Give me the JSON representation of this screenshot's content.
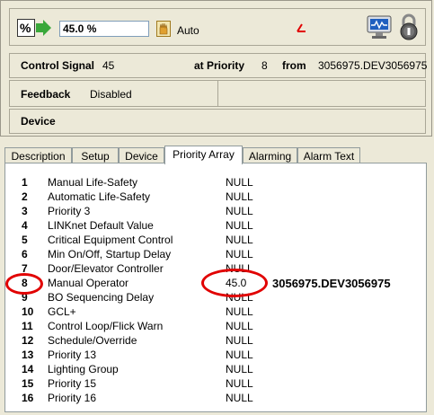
{
  "header": {
    "value": "45.0 %",
    "mode": "Auto"
  },
  "control": {
    "label": "Control Signal",
    "value": "45",
    "priority_label": "at Priority",
    "priority": "8",
    "from_label": "from",
    "source": "3056975.DEV3056975"
  },
  "feedback": {
    "label": "Feedback",
    "value": "Disabled"
  },
  "device": {
    "label": "Device"
  },
  "tabs": [
    "Description",
    "Setup",
    "Device",
    "Priority Array",
    "Alarming",
    "Alarm Text"
  ],
  "priority_array": [
    {
      "num": "1",
      "name": "Manual Life-Safety",
      "value": "NULL"
    },
    {
      "num": "2",
      "name": "Automatic Life-Safety",
      "value": "NULL"
    },
    {
      "num": "3",
      "name": "Priority 3",
      "value": "NULL"
    },
    {
      "num": "4",
      "name": "LINKnet Default Value",
      "value": "NULL"
    },
    {
      "num": "5",
      "name": "Critical Equipment Control",
      "value": "NULL"
    },
    {
      "num": "6",
      "name": "Min On/Off, Startup Delay",
      "value": "NULL"
    },
    {
      "num": "7",
      "name": "Door/Elevator Controller",
      "value": "NULL"
    },
    {
      "num": "8",
      "name": "Manual Operator",
      "value": "45.0"
    },
    {
      "num": "9",
      "name": "BO Sequencing Delay",
      "value": "NULL"
    },
    {
      "num": "10",
      "name": "GCL+",
      "value": "NULL"
    },
    {
      "num": "11",
      "name": "Control Loop/Flick Warn",
      "value": "NULL"
    },
    {
      "num": "12",
      "name": "Schedule/Override",
      "value": "NULL"
    },
    {
      "num": "13",
      "name": "Priority 13",
      "value": "NULL"
    },
    {
      "num": "14",
      "name": "Lighting Group",
      "value": "NULL"
    },
    {
      "num": "15",
      "name": "Priority 15",
      "value": "NULL"
    },
    {
      "num": "16",
      "name": "Priority 16",
      "value": "NULL"
    }
  ],
  "annotation": {
    "source": "3056975.DEV3056975"
  },
  "colors": {
    "highlight": "#e10000",
    "background": "#ece9d8"
  }
}
